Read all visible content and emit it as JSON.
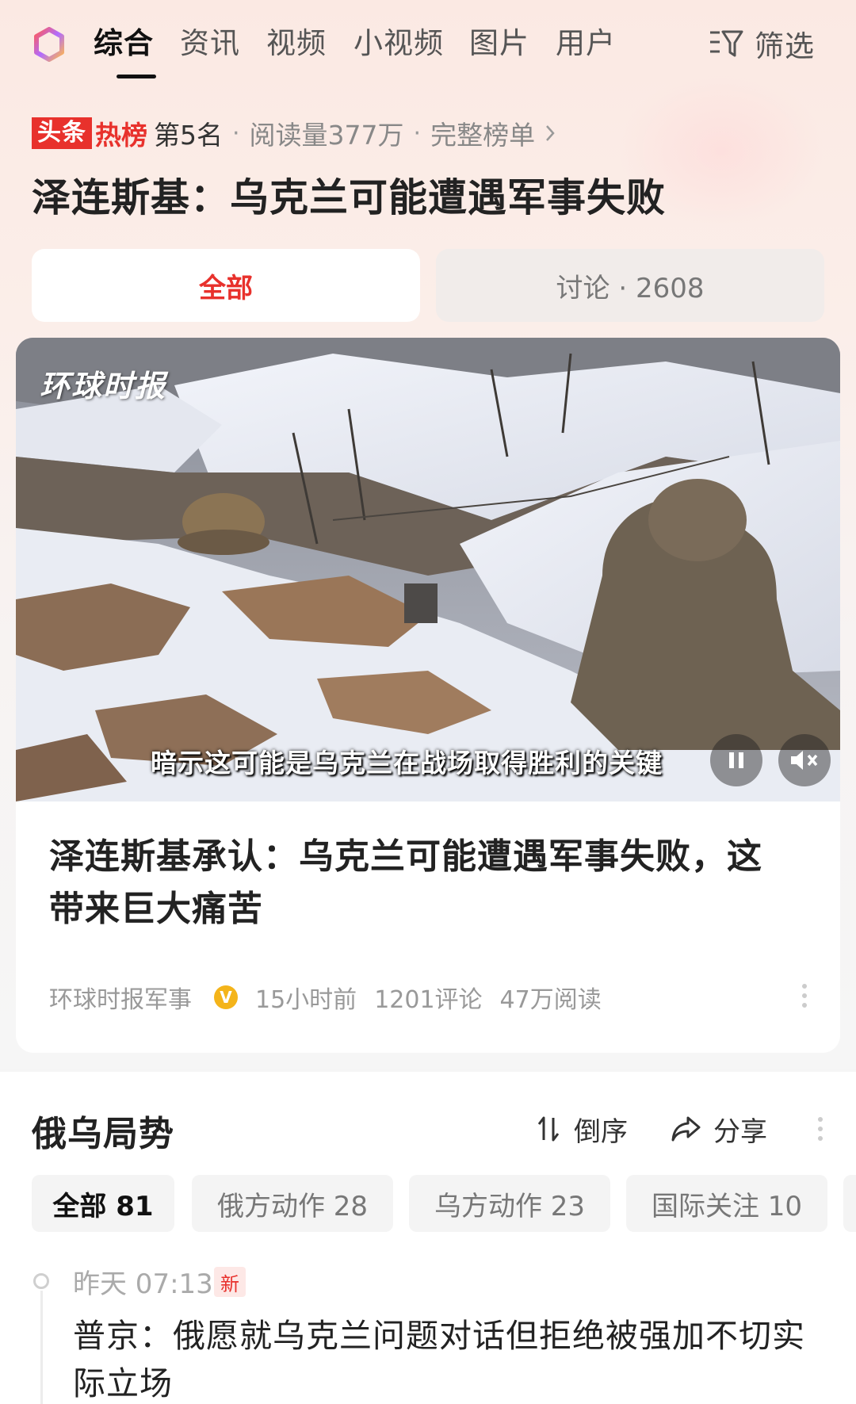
{
  "top_tabs": [
    "综合",
    "资讯",
    "视频",
    "小视频",
    "图片",
    "用户"
  ],
  "filter_label": "筛选",
  "rank": {
    "badge_toutiao": "头条",
    "badge_hot": "热榜",
    "position": "第5名",
    "reads": "阅读量377万",
    "full_list": "完整榜单"
  },
  "headline": "泽连斯基：乌克兰可能遭遇军事失败",
  "segments": {
    "all": "全部",
    "discussion": "讨论 · 2608"
  },
  "article": {
    "watermark": "环球时报",
    "subtitle": "暗示这可能是乌克兰在战场取得胜利的关键",
    "title": "泽连斯基承认：乌克兰可能遭遇军事失败，这带来巨大痛苦",
    "source": "环球时报军事",
    "verified_mark": "V",
    "time": "15小时前",
    "comments": "1201评论",
    "reads": "47万阅读"
  },
  "section": {
    "title": "俄乌局势",
    "sort_label": "倒序",
    "share_label": "分享",
    "chips": [
      "全部 81",
      "俄方动作 28",
      "乌方动作 23",
      "国际关注 10"
    ]
  },
  "timeline": [
    {
      "time": "昨天 07:13",
      "badge": "新",
      "text": "普京：俄愿就乌克兰问题对话但拒绝被强加不切实际立场"
    }
  ],
  "colors": {
    "accent_red": "#e8312c",
    "verified_gold": "#f4b41a"
  }
}
